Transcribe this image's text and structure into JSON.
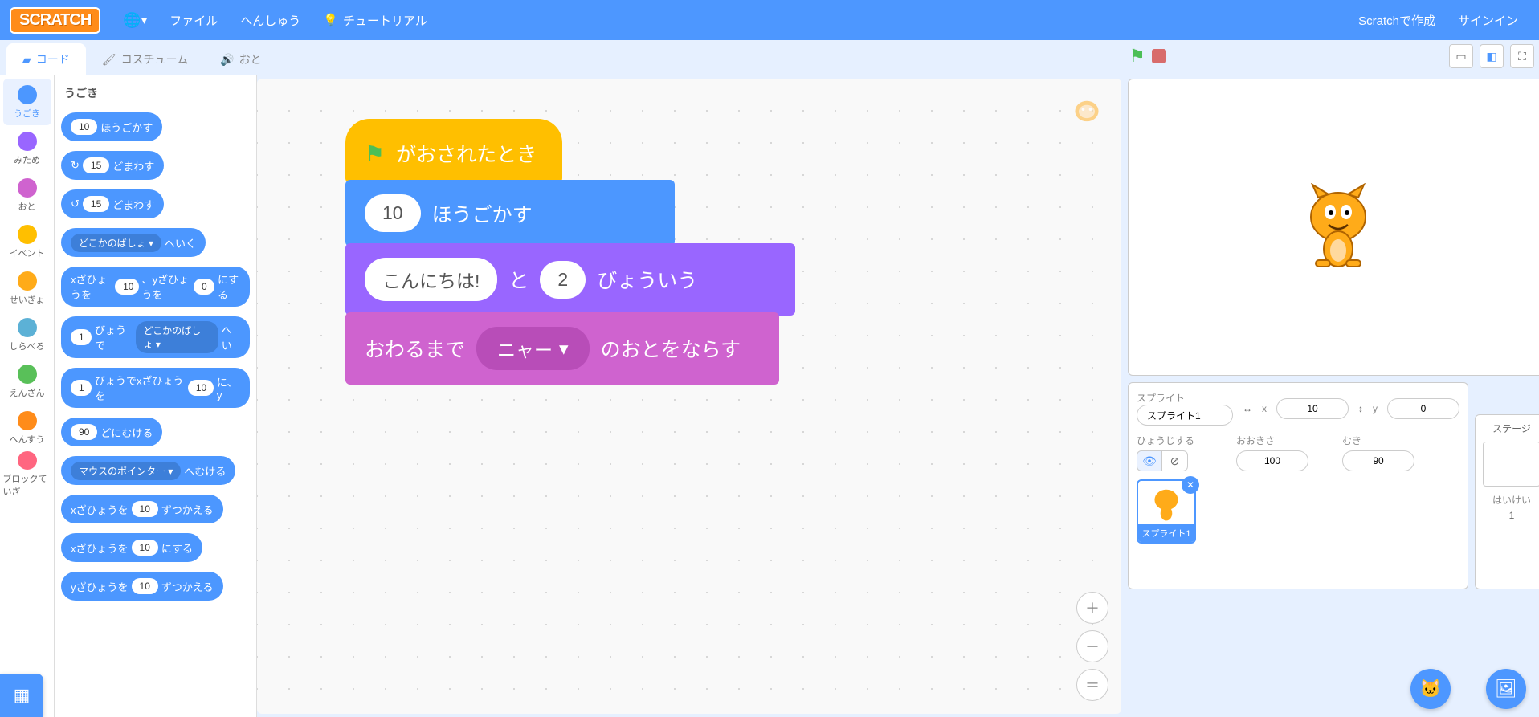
{
  "menubar": {
    "logo": "SCRATCH",
    "file": "ファイル",
    "edit": "へんしゅう",
    "tutorials": "チュートリアル",
    "join": "Scratchで作成",
    "signin": "サインイン"
  },
  "tabs": {
    "code": "コード",
    "costumes": "コスチューム",
    "sounds": "おと"
  },
  "categories": [
    {
      "label": "うごき",
      "color": "#4c97ff"
    },
    {
      "label": "みため",
      "color": "#9966ff"
    },
    {
      "label": "おと",
      "color": "#cf63cf"
    },
    {
      "label": "イベント",
      "color": "#ffbf00"
    },
    {
      "label": "せいぎょ",
      "color": "#ffab19"
    },
    {
      "label": "しらべる",
      "color": "#5cb1d6"
    },
    {
      "label": "えんざん",
      "color": "#59c059"
    },
    {
      "label": "へんすう",
      "color": "#ff8c1a"
    },
    {
      "label": "ブロックていぎ",
      "color": "#ff6680"
    }
  ],
  "palette": {
    "title": "うごき",
    "blocks": [
      {
        "parts": [
          {
            "t": "pill",
            "v": "10"
          },
          {
            "t": "txt",
            "v": "ほうごかす"
          }
        ]
      },
      {
        "parts": [
          {
            "t": "txt",
            "v": "↻"
          },
          {
            "t": "pill",
            "v": "15"
          },
          {
            "t": "txt",
            "v": "どまわす"
          }
        ]
      },
      {
        "parts": [
          {
            "t": "txt",
            "v": "↺"
          },
          {
            "t": "pill",
            "v": "15"
          },
          {
            "t": "txt",
            "v": "どまわす"
          }
        ]
      },
      {
        "parts": [
          {
            "t": "dd",
            "v": "どこかのばしょ ▾"
          },
          {
            "t": "txt",
            "v": "へいく"
          }
        ]
      },
      {
        "parts": [
          {
            "t": "txt",
            "v": "xざひょうを"
          },
          {
            "t": "pill",
            "v": "10"
          },
          {
            "t": "txt",
            "v": "、yざひょうを"
          },
          {
            "t": "pill",
            "v": "0"
          },
          {
            "t": "txt",
            "v": "にする"
          }
        ]
      },
      {
        "parts": [
          {
            "t": "pill",
            "v": "1"
          },
          {
            "t": "txt",
            "v": "びょうで"
          },
          {
            "t": "dd",
            "v": "どこかのばしょ ▾"
          },
          {
            "t": "txt",
            "v": "へい"
          }
        ]
      },
      {
        "parts": [
          {
            "t": "pill",
            "v": "1"
          },
          {
            "t": "txt",
            "v": "びょうでxざひょうを"
          },
          {
            "t": "pill",
            "v": "10"
          },
          {
            "t": "txt",
            "v": "に、y"
          }
        ]
      },
      {
        "parts": [
          {
            "t": "pill",
            "v": "90"
          },
          {
            "t": "txt",
            "v": "どにむける"
          }
        ]
      },
      {
        "parts": [
          {
            "t": "dd",
            "v": "マウスのポインター ▾"
          },
          {
            "t": "txt",
            "v": "へむける"
          }
        ]
      },
      {
        "parts": [
          {
            "t": "txt",
            "v": "xざひょうを"
          },
          {
            "t": "pill",
            "v": "10"
          },
          {
            "t": "txt",
            "v": "ずつかえる"
          }
        ]
      },
      {
        "parts": [
          {
            "t": "txt",
            "v": "xざひょうを"
          },
          {
            "t": "pill",
            "v": "10"
          },
          {
            "t": "txt",
            "v": "にする"
          }
        ]
      },
      {
        "parts": [
          {
            "t": "txt",
            "v": "yざひょうを"
          },
          {
            "t": "pill",
            "v": "10"
          },
          {
            "t": "txt",
            "v": "ずつかえる"
          }
        ]
      }
    ]
  },
  "script": {
    "hat_label": "がおされたとき",
    "move": {
      "val": "10",
      "label": "ほうごかす"
    },
    "say": {
      "text": "こんにちは!",
      "mid": "と",
      "secs": "2",
      "label": "びょういう"
    },
    "sound": {
      "pre": "おわるまで",
      "name": "ニャー",
      "post": "のおとをならす"
    }
  },
  "sprite_panel": {
    "title": "スプライト",
    "name": "スプライト1",
    "x_label": "x",
    "x": "10",
    "y_label": "y",
    "y": "0",
    "show_label": "ひょうじする",
    "size_label": "おおきさ",
    "size": "100",
    "dir_label": "むき",
    "dir": "90",
    "tile_label": "スプライト1"
  },
  "stage_panel": {
    "title": "ステージ",
    "backdrop_label": "はいけい",
    "count": "1"
  }
}
